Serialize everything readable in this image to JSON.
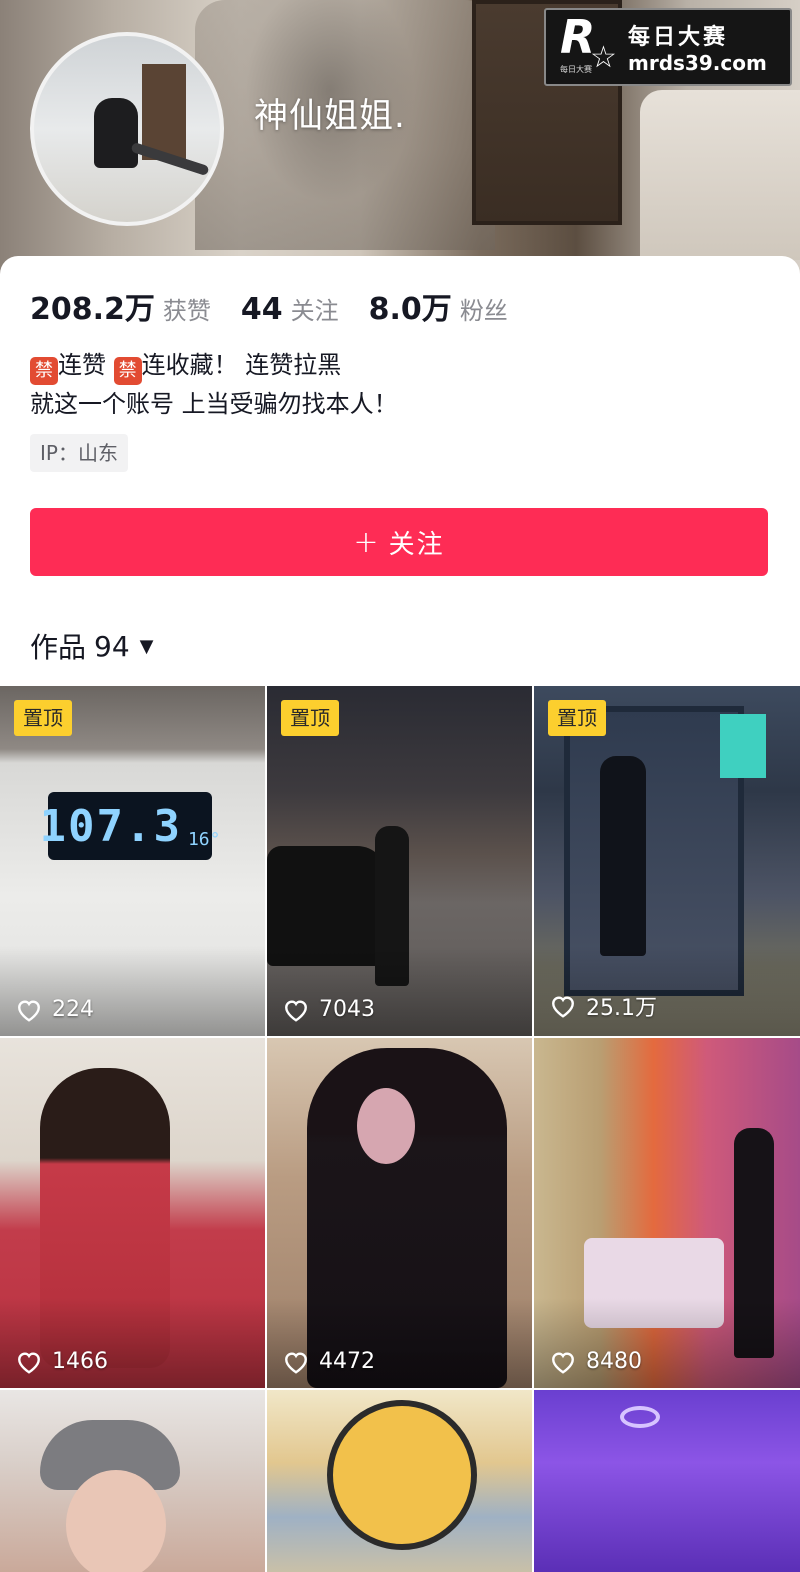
{
  "profile": {
    "nickname": "神仙姐姐.",
    "stats": [
      {
        "value": "208.2万",
        "label": "获赞"
      },
      {
        "value": "44",
        "label": "关注"
      },
      {
        "value": "8.0万",
        "label": "粉丝"
      }
    ],
    "bio": {
      "line1": {
        "ban1": "禁",
        "text1": "连赞 ",
        "ban2": "禁",
        "text2": "连收藏！ 连赞拉黑"
      },
      "line2": "就这一个账号 上当受骗勿找本人！"
    },
    "ip": "IP：山东",
    "follow_button": "关注",
    "works_label": "作品",
    "works_count": "94"
  },
  "watermark": {
    "cn": "每日大赛",
    "url": "mrds39.com",
    "logo_letter": "R",
    "logo_small": "每日大赛"
  },
  "grid": {
    "pin_label": "置顶",
    "tiles": [
      {
        "likes": "224",
        "pinned": true,
        "scale_value": "107.3",
        "scale_unit": "16°"
      },
      {
        "likes": "7043",
        "pinned": true
      },
      {
        "likes": "25.1万",
        "pinned": true
      },
      {
        "likes": "1466",
        "pinned": false
      },
      {
        "likes": "4472",
        "pinned": false
      },
      {
        "likes": "8480",
        "pinned": false
      },
      {
        "pinned": false
      },
      {
        "pinned": false
      },
      {
        "pinned": false
      }
    ]
  },
  "colors": {
    "accent": "#fe2c55",
    "pin_badge": "#fccf2e",
    "ban_badge": "#e24b32"
  },
  "icons": {
    "likes": "heart-outline-icon",
    "works_dropdown": "caret-down-icon",
    "follow": "plus-icon"
  }
}
